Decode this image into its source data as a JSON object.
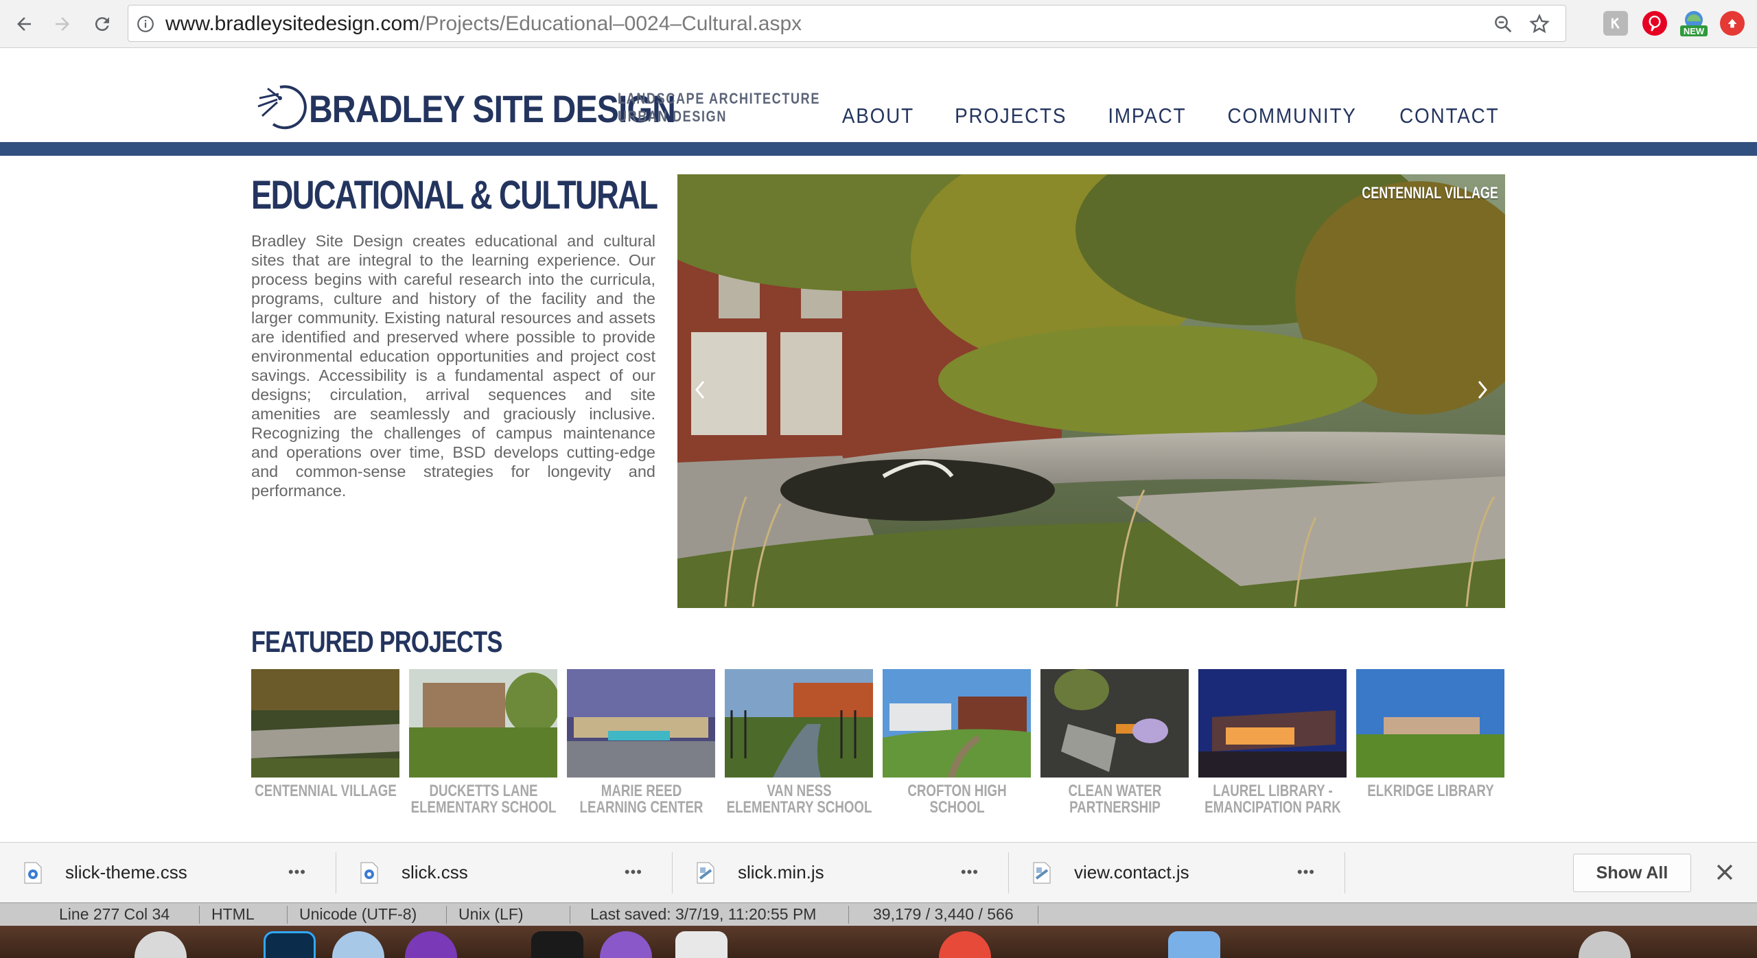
{
  "browser": {
    "url_host": "www.bradleysitedesign.com",
    "url_path": "/Projects/Educational–0024–Cultural.aspx",
    "extensions": [
      {
        "name": "grey-extension-icon",
        "color": "#b9b9b9"
      },
      {
        "name": "pinterest-icon",
        "color": "#e60023"
      },
      {
        "name": "new-extension-icon",
        "color": "#2f9a3c",
        "badge": "NEW"
      },
      {
        "name": "red-upload-icon",
        "color": "#e53935"
      }
    ]
  },
  "site": {
    "logo_name": "BRADLEY SITE DESIGN",
    "logo_tag_line1": "LANDSCAPE ARCHITECTURE",
    "logo_tag_line2": "URBAN DESIGN",
    "nav": [
      "ABOUT",
      "PROJECTS",
      "IMPACT",
      "COMMUNITY",
      "CONTACT"
    ],
    "brand_color": "#23345e",
    "bar_color": "#32507f"
  },
  "main": {
    "title": "EDUCATIONAL & CULTURAL",
    "intro": "Bradley Site Design creates educational and cultural sites that are integral to the learning experience. Our process begins with careful research into the curricula, programs, culture and history of the facility and the larger community. Existing natural resources and assets are identified and preserved where possible to provide environmental education opportunities and project cost savings. Accessibility is a fundamental aspect of our designs; circulation, arrival sequences and site amenities are seamlessly and graciously inclusive. Recognizing the challenges of campus maintenance and operations over time, BSD develops cutting-edge and common-sense strategies for longevity and performance.",
    "hero_caption": "CENTENNIAL VILLAGE"
  },
  "featured": {
    "title": "FEATURED PROJECTS",
    "projects": [
      "CENTENNIAL VILLAGE",
      "DUCKETTS LANE ELEMENTARY SCHOOL",
      "MARIE REED LEARNING CENTER",
      "VAN NESS ELEMENTARY SCHOOL",
      "CROFTON HIGH SCHOOL",
      "CLEAN WATER PARTNERSHIP",
      "LAUREL LIBRARY - EMANCIPATION PARK",
      "ELKRIDGE LIBRARY"
    ]
  },
  "downloads": {
    "items": [
      "slick-theme.css",
      "slick.css",
      "slick.min.js",
      "view.contact.js"
    ],
    "more_label": "•••",
    "show_all": "Show All"
  },
  "statusbar": {
    "position": "Line 277 Col 34",
    "language": "HTML",
    "encoding": "Unicode (UTF-8)",
    "line_endings": "Unix (LF)",
    "last_saved": "Last saved: 3/7/19, 11:20:55 PM",
    "counts": "39,179 / 3,440 / 566"
  }
}
